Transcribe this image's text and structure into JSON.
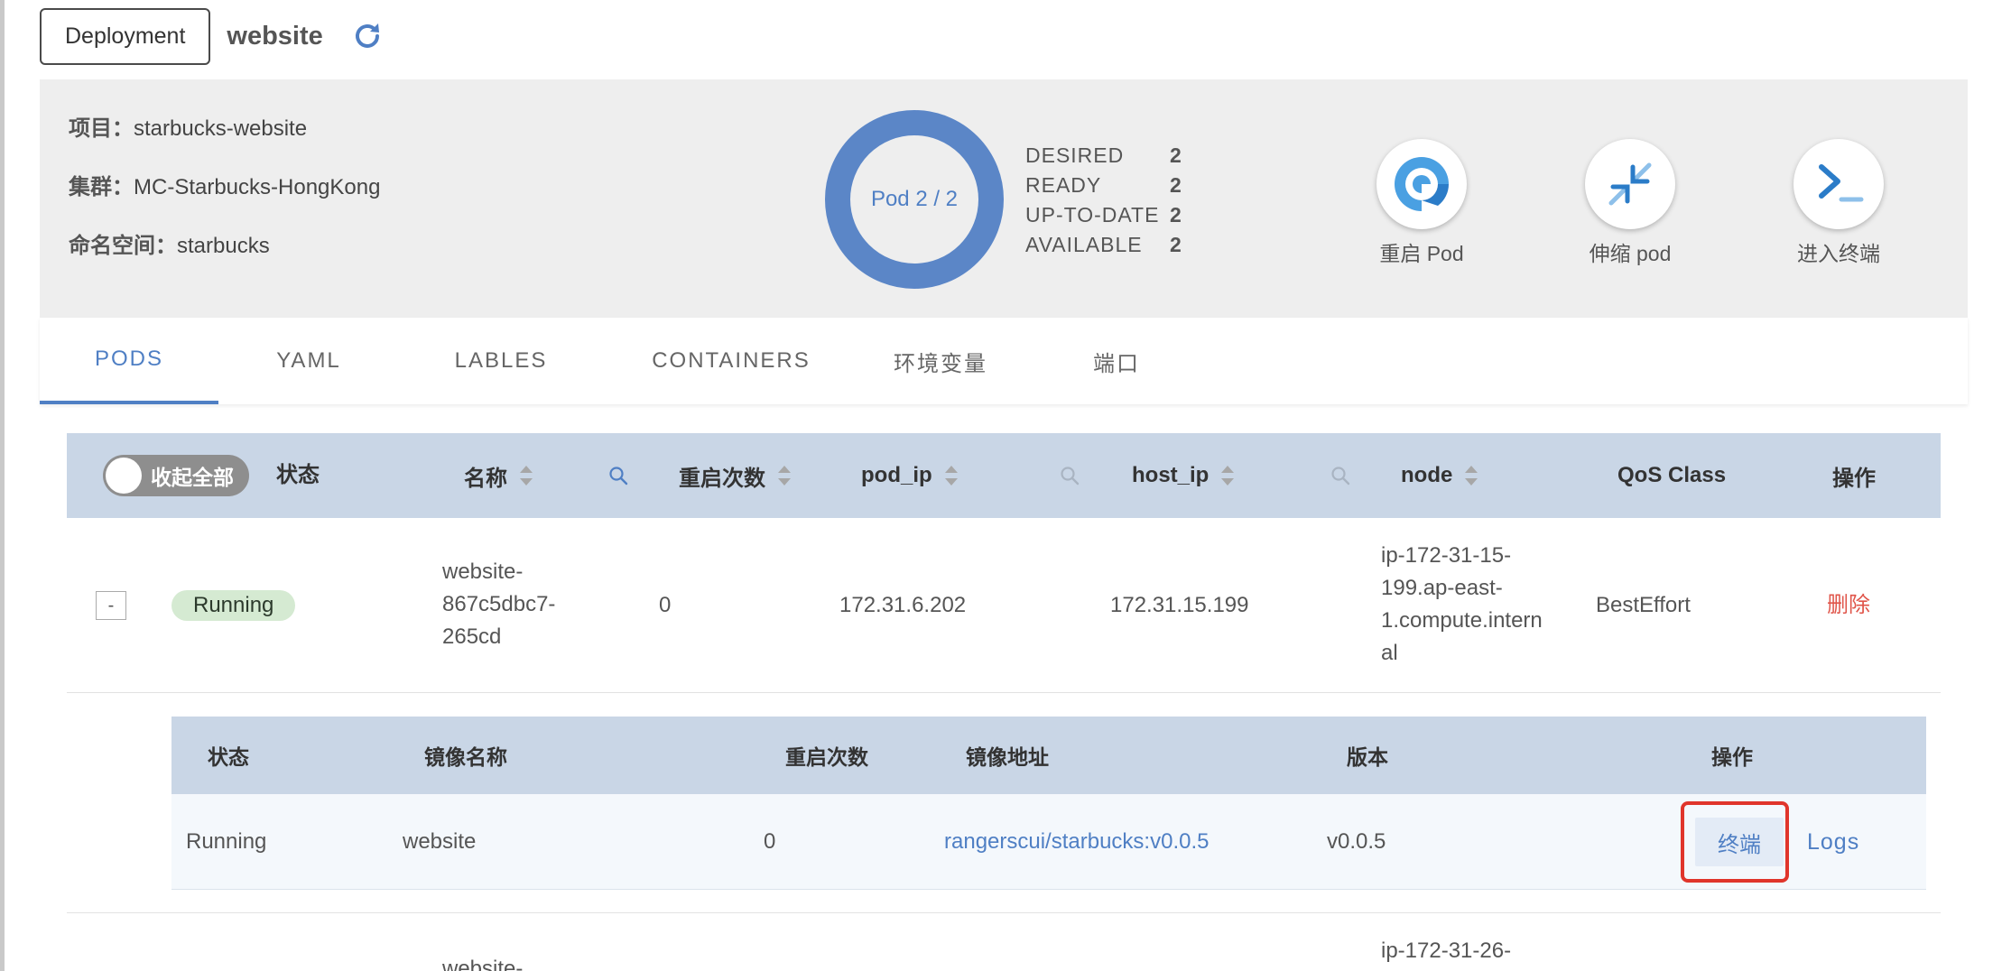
{
  "header": {
    "kind_label": "Deployment",
    "name": "website",
    "refresh_icon": "refresh-icon"
  },
  "info": {
    "project_key": "项目：",
    "project_value": "starbucks-website",
    "cluster_key": "集群：",
    "cluster_value": "MC-Starbucks-HongKong",
    "namespace_key": "命名空间：",
    "namespace_value": "starbucks",
    "pod_label": "Pod 2 / 2",
    "pods_ready_fraction": 1.0,
    "stats": [
      {
        "label": "DESIRED",
        "value": "2"
      },
      {
        "label": "READY",
        "value": "2"
      },
      {
        "label": "UP-TO-DATE",
        "value": "2"
      },
      {
        "label": "AVAILABLE",
        "value": "2"
      }
    ],
    "actions": [
      {
        "label": "重启 Pod",
        "icon": "restart-icon"
      },
      {
        "label": "伸缩 pod",
        "icon": "compress-icon"
      },
      {
        "label": "进入终端",
        "icon": "terminal-icon"
      }
    ],
    "accent_color": "#5b86c7"
  },
  "tabs": [
    {
      "label": "PODS",
      "active": true
    },
    {
      "label": "YAML",
      "active": false
    },
    {
      "label": "LABLES",
      "active": false
    },
    {
      "label": "CONTAINERS",
      "active": false
    },
    {
      "label": "环境变量",
      "active": false
    },
    {
      "label": "端口",
      "active": false
    }
  ],
  "pods_table": {
    "toggle_label": "收起全部",
    "columns": [
      "状态",
      "名称",
      "重启次数",
      "pod_ip",
      "host_ip",
      "node",
      "QoS Class",
      "操作"
    ],
    "rows": [
      {
        "expand": "-",
        "status": "Running",
        "name_lines": [
          "website-",
          "867c5dbc7-",
          "265cd"
        ],
        "restarts": "0",
        "pod_ip": "172.31.6.202",
        "host_ip": "172.31.15.199",
        "node_lines": [
          "ip-172-31-15-",
          "199.ap-east-",
          "1.compute.intern",
          "al"
        ],
        "qos": "BestEffort",
        "action": "删除"
      }
    ],
    "partial_row": {
      "name_line": "website-",
      "node_line": "ip-172-31-26-"
    }
  },
  "containers_table": {
    "columns": [
      "状态",
      "镜像名称",
      "重启次数",
      "镜像地址",
      "版本",
      "操作"
    ],
    "rows": [
      {
        "status": "Running",
        "image_name": "website",
        "restarts": "0",
        "image": "rangerscui/starbucks:v0.0.5",
        "version": "v0.0.5",
        "terminal_label": "终端",
        "logs_label": "Logs"
      }
    ]
  }
}
